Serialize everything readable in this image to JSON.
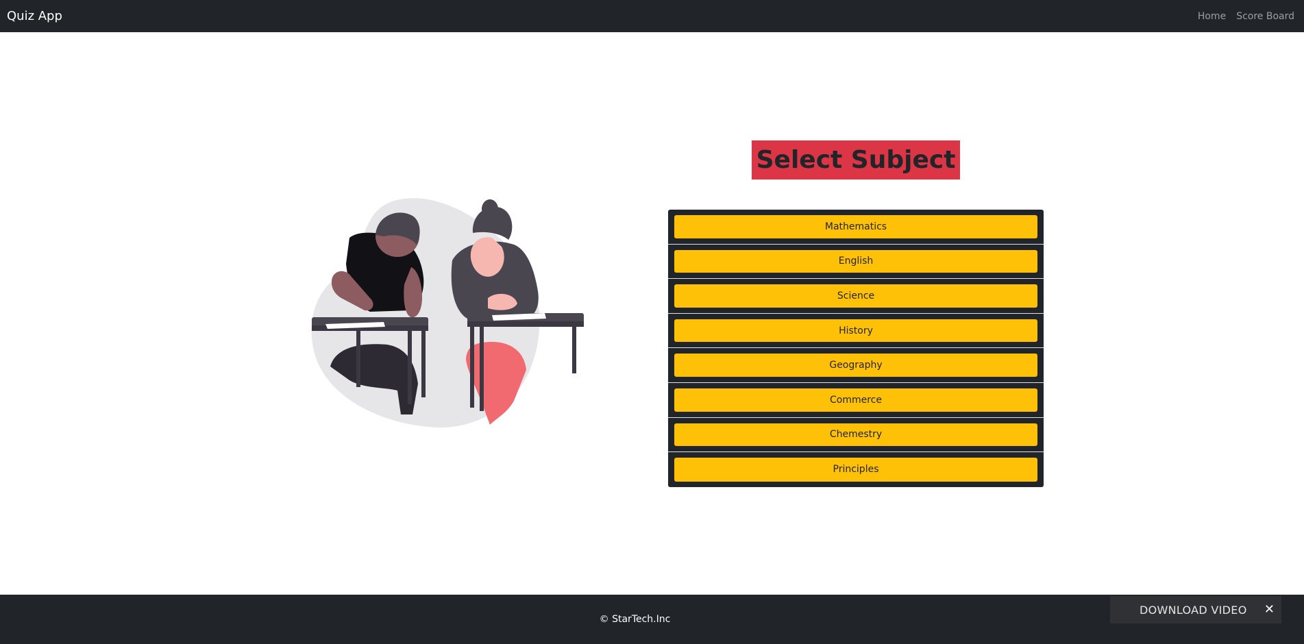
{
  "navbar": {
    "brand": "Quiz App",
    "links": [
      {
        "label": "Home"
      },
      {
        "label": "Score Board"
      }
    ]
  },
  "main": {
    "title": "Select Subject",
    "subjects": [
      {
        "label": "Mathematics"
      },
      {
        "label": "English"
      },
      {
        "label": "Science"
      },
      {
        "label": "History"
      },
      {
        "label": "Geography"
      },
      {
        "label": "Commerce"
      },
      {
        "label": "Chemestry"
      },
      {
        "label": "Principles"
      }
    ]
  },
  "illustration": {
    "icon": "students-taking-exam-illustration"
  },
  "footer": {
    "copyright": "© StarTech.Inc"
  },
  "download_bar": {
    "label": "DOWNLOAD VIDEO",
    "close_icon": "close-icon"
  },
  "colors": {
    "navbar_bg": "#212529",
    "title_bg": "#dc3545",
    "subject_button": "#ffc107",
    "list_bg": "#212529"
  }
}
